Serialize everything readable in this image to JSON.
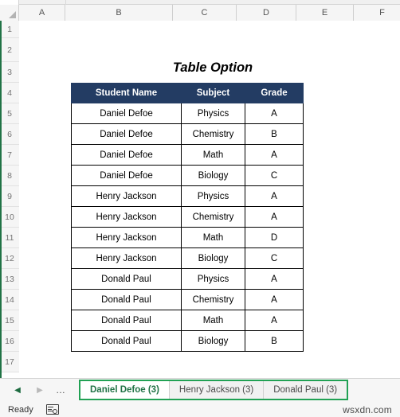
{
  "app": {
    "type": "spreadsheet",
    "status_text": "Ready",
    "watermark": "wsxdn.com",
    "accent_green": "#217346",
    "header_fill": "#233C63"
  },
  "grid": {
    "columns": [
      {
        "label": "A",
        "width": 58
      },
      {
        "label": "B",
        "width": 135
      },
      {
        "label": "C",
        "width": 80
      },
      {
        "label": "D",
        "width": 75
      },
      {
        "label": "E",
        "width": 72
      },
      {
        "label": "F",
        "width": 72
      }
    ],
    "rows": [
      {
        "label": "1",
        "height": 22
      },
      {
        "label": "2",
        "height": 30
      },
      {
        "label": "3",
        "height": 26
      },
      {
        "label": "4",
        "height": 26
      },
      {
        "label": "5",
        "height": 26
      },
      {
        "label": "6",
        "height": 26
      },
      {
        "label": "7",
        "height": 26
      },
      {
        "label": "8",
        "height": 26
      },
      {
        "label": "9",
        "height": 26
      },
      {
        "label": "10",
        "height": 26
      },
      {
        "label": "11",
        "height": 26
      },
      {
        "label": "12",
        "height": 26
      },
      {
        "label": "13",
        "height": 26
      },
      {
        "label": "14",
        "height": 26
      },
      {
        "label": "15",
        "height": 26
      },
      {
        "label": "16",
        "height": 26
      },
      {
        "label": "17",
        "height": 26
      }
    ]
  },
  "sheet": {
    "title": "Table Option"
  },
  "table": {
    "headers": [
      "Student Name",
      "Subject",
      "Grade"
    ],
    "rows": [
      [
        "Daniel Defoe",
        "Physics",
        "A"
      ],
      [
        "Daniel Defoe",
        "Chemistry",
        "B"
      ],
      [
        "Daniel Defoe",
        "Math",
        "A"
      ],
      [
        "Daniel Defoe",
        "Biology",
        "C"
      ],
      [
        "Henry Jackson",
        "Physics",
        "A"
      ],
      [
        "Henry Jackson",
        "Chemistry",
        "A"
      ],
      [
        "Henry Jackson",
        "Math",
        "D"
      ],
      [
        "Henry Jackson",
        "Biology",
        "C"
      ],
      [
        "Donald Paul",
        "Physics",
        "A"
      ],
      [
        "Donald Paul",
        "Chemistry",
        "A"
      ],
      [
        "Donald Paul",
        "Math",
        "A"
      ],
      [
        "Donald Paul",
        "Biology",
        "B"
      ]
    ]
  },
  "tab_bar": {
    "nav": {
      "prev_icon": "◀",
      "next_icon": "▶",
      "more_icon": "…"
    },
    "tabs": [
      {
        "label": "Daniel Defoe (3)",
        "active": true
      },
      {
        "label": "Henry Jackson (3)",
        "active": false
      },
      {
        "label": "Donald Paul (3)",
        "active": false
      }
    ]
  }
}
